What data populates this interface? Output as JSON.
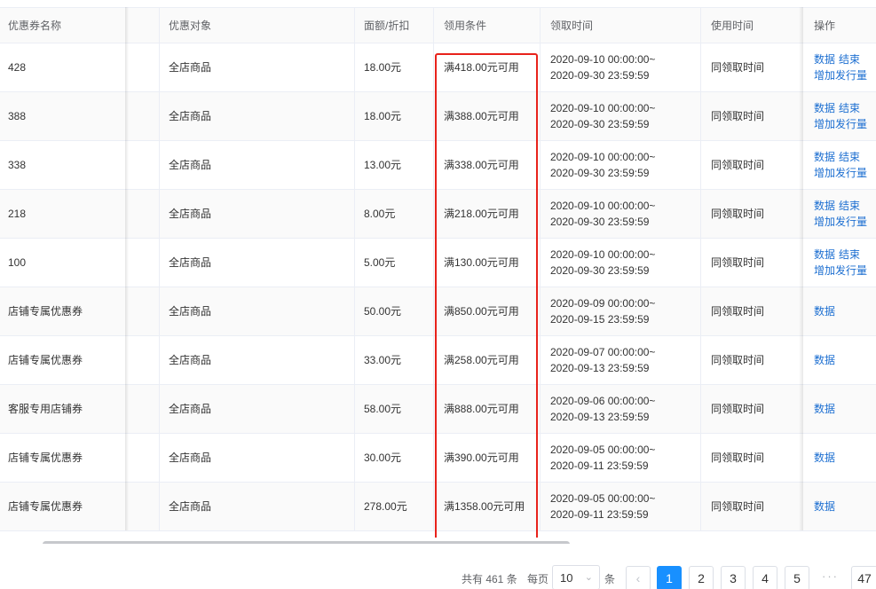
{
  "table": {
    "headers": [
      "优惠券名称",
      "优惠对象",
      "面额/折扣",
      "领用条件",
      "领取时间",
      "使用时间",
      "操作"
    ],
    "rows": [
      {
        "name": "428",
        "target": "全店商品",
        "amount": "18.00元",
        "condition": "满418.00元可用",
        "time_start": "2020-09-10 00:00:00~",
        "time_end": "2020-09-30 23:59:59",
        "use_time": "同领取时间",
        "op1": "数据",
        "op2": "结束",
        "op3": "增加发行量"
      },
      {
        "name": "388",
        "target": "全店商品",
        "amount": "18.00元",
        "condition": "满388.00元可用",
        "time_start": "2020-09-10 00:00:00~",
        "time_end": "2020-09-30 23:59:59",
        "use_time": "同领取时间",
        "op1": "数据",
        "op2": "结束",
        "op3": "增加发行量"
      },
      {
        "name": "338",
        "target": "全店商品",
        "amount": "13.00元",
        "condition": "满338.00元可用",
        "time_start": "2020-09-10 00:00:00~",
        "time_end": "2020-09-30 23:59:59",
        "use_time": "同领取时间",
        "op1": "数据",
        "op2": "结束",
        "op3": "增加发行量"
      },
      {
        "name": "218",
        "target": "全店商品",
        "amount": "8.00元",
        "condition": "满218.00元可用",
        "time_start": "2020-09-10 00:00:00~",
        "time_end": "2020-09-30 23:59:59",
        "use_time": "同领取时间",
        "op1": "数据",
        "op2": "结束",
        "op3": "增加发行量"
      },
      {
        "name": "100",
        "target": "全店商品",
        "amount": "5.00元",
        "condition": "满130.00元可用",
        "time_start": "2020-09-10 00:00:00~",
        "time_end": "2020-09-30 23:59:59",
        "use_time": "同领取时间",
        "op1": "数据",
        "op2": "结束",
        "op3": "增加发行量"
      },
      {
        "name": "店铺专属优惠券",
        "target": "全店商品",
        "amount": "50.00元",
        "condition": "满850.00元可用",
        "time_start": "2020-09-09 00:00:00~",
        "time_end": "2020-09-15 23:59:59",
        "use_time": "同领取时间",
        "op1": "数据"
      },
      {
        "name": "店铺专属优惠券",
        "target": "全店商品",
        "amount": "33.00元",
        "condition": "满258.00元可用",
        "time_start": "2020-09-07 00:00:00~",
        "time_end": "2020-09-13 23:59:59",
        "use_time": "同领取时间",
        "op1": "数据"
      },
      {
        "name": "客服专用店铺券",
        "target": "全店商品",
        "amount": "58.00元",
        "condition": "满888.00元可用",
        "time_start": "2020-09-06 00:00:00~",
        "time_end": "2020-09-13 23:59:59",
        "use_time": "同领取时间",
        "op1": "数据"
      },
      {
        "name": "店铺专属优惠券",
        "target": "全店商品",
        "amount": "30.00元",
        "condition": "满390.00元可用",
        "time_start": "2020-09-05 00:00:00~",
        "time_end": "2020-09-11 23:59:59",
        "use_time": "同领取时间",
        "op1": "数据"
      },
      {
        "name": "店铺专属优惠券",
        "target": "全店商品",
        "amount": "278.00元",
        "condition": "满1358.00元可用",
        "time_start": "2020-09-05 00:00:00~",
        "time_end": "2020-09-11 23:59:59",
        "use_time": "同领取时间",
        "op1": "数据"
      }
    ]
  },
  "pagination": {
    "total_label": "共有 461 条",
    "per_page_label": "每页",
    "page_size": "10",
    "unit_label": "条",
    "prev_icon": "chevron-left-icon",
    "pages": [
      "1",
      "2",
      "3",
      "4",
      "5"
    ],
    "current_page": "1",
    "ellipsis": "···",
    "last_page": "47"
  },
  "colors": {
    "link": "#1d6fd1",
    "highlight_border": "#e8221b",
    "active_page": "#1890ff"
  }
}
